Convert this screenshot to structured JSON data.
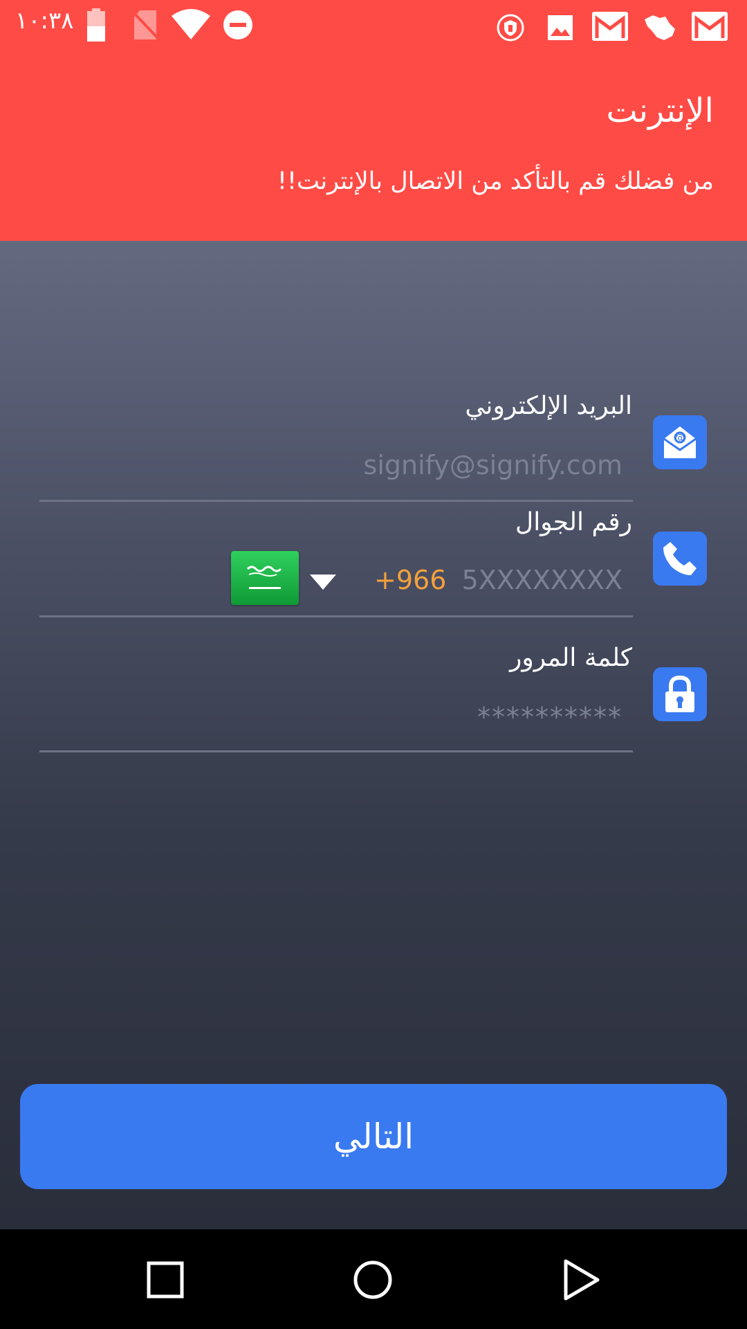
{
  "status_bar": {
    "time": "١٠:٣٨",
    "icons": [
      "battery-icon",
      "no-sim-icon",
      "wifi-icon",
      "do-not-disturb-icon",
      "vpn-shield-icon",
      "image-icon",
      "gmail-icon",
      "saudi-map-icon",
      "gmail-icon"
    ]
  },
  "alert": {
    "title": "الإنترنت",
    "message": "من فضلك قم بالتأكد من الاتصال بالإنترنت!!"
  },
  "form": {
    "email": {
      "label": "البريد الإلكتروني",
      "placeholder": "signify@signify.com",
      "icon": "email-icon"
    },
    "phone": {
      "label": "رقم الجوال",
      "placeholder": "5XXXXXXXX",
      "dial_code": "+966",
      "country": "Saudi Arabia",
      "icon": "phone-icon"
    },
    "password": {
      "label": "كلمة المرور",
      "placeholder": "**********",
      "icon": "lock-icon"
    }
  },
  "next_button": {
    "label": "التالي"
  },
  "colors": {
    "alert_bg": "#ff4b46",
    "accent_blue": "#3a7af0",
    "dial_code": "#f3a13c",
    "placeholder": "#7c8196"
  },
  "nav": {
    "buttons": [
      "recent-apps-icon",
      "home-icon",
      "back-icon"
    ]
  }
}
